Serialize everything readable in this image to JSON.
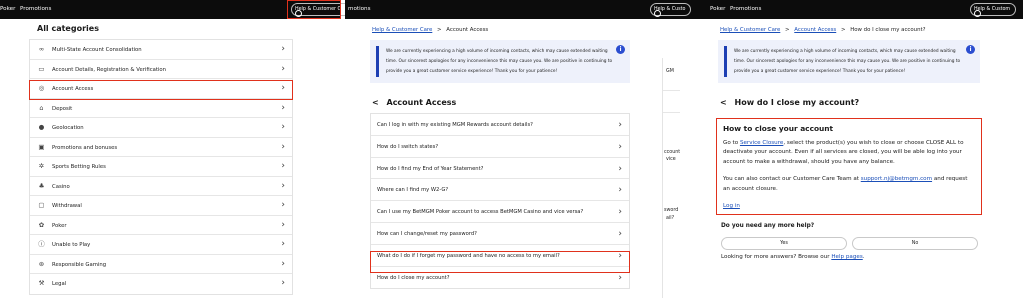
{
  "panel1": {
    "nav": [
      "Poker",
      "Promotions"
    ],
    "help_btn": "Help & Customer Care",
    "title": "All categories",
    "categories": [
      {
        "label": "Multi-State Account Consolidation",
        "icon": "link-icon"
      },
      {
        "label": "Account Details, Registration & Verification",
        "icon": "id-card-icon"
      },
      {
        "label": "Account Access",
        "icon": "access-icon"
      },
      {
        "label": "Deposit",
        "icon": "bank-icon"
      },
      {
        "label": "Geolocation",
        "icon": "location-pin-icon"
      },
      {
        "label": "Promotions and bonuses",
        "icon": "gift-icon"
      },
      {
        "label": "Sports Betting Rules",
        "icon": "rules-icon"
      },
      {
        "label": "Casino",
        "icon": "casino-icon"
      },
      {
        "label": "Withdrawal",
        "icon": "withdrawal-icon"
      },
      {
        "label": "Poker",
        "icon": "poker-chip-icon"
      },
      {
        "label": "Unable to Play",
        "icon": "info-icon"
      },
      {
        "label": "Responsible Gaming",
        "icon": "responsible-gaming-icon"
      },
      {
        "label": "Legal",
        "icon": "gavel-icon"
      }
    ]
  },
  "panel2": {
    "nav": [
      "motions"
    ],
    "sliver_text": [
      "GM",
      "ccount",
      "vice",
      "sword",
      "ail?"
    ],
    "breadcrumb": {
      "root": "Help & Customer Care",
      "sep": ">",
      "current": "Account Access"
    },
    "notice": "We are currently experiencing a high volume of incoming contacts, which may cause extended waiting time. Our sincerest apologies for any inconvenience this may cause you. We are positive in continuing to provide you a great customer service experience! Thank you for your patience!",
    "title": "Account Access",
    "back_glyph": "<",
    "questions": [
      "Can I log in with my existing MGM Rewards account details?",
      "How do I switch states?",
      "How do I find my End of Year Statement?",
      "Where can I find my W2-G?",
      "Can I use my BetMGM Poker account to access BetMGM Casino and vice versa?",
      "How can I change/reset my password?",
      "What do I do if I forget my password and have no access to my email?",
      "How do I close my account?"
    ]
  },
  "panel3": {
    "nav": [
      "Poker",
      "Promotions"
    ],
    "help_btn_clipped": "Help & Custo",
    "help_btn": "Help & Custom",
    "breadcrumb": {
      "root": "Help & Customer Care",
      "sep": ">",
      "mid": "Account Access",
      "current": "How do I close my account?"
    },
    "notice": "We are currently experiencing a high volume of incoming contacts, which may cause extended waiting time. Our sincerest apologies for any inconvenience this may cause you. We are positive in continuing to provide you a great customer service experience! Thank you for your patience!",
    "title": "How do I close my account?",
    "answer": {
      "heading": "How to close your account",
      "p1_pre": "Go to ",
      "p1_link": "Service Closure",
      "p1_post": ", select the product(s) you wish to close or choose CLOSE ALL to deactivate your account. Even if all services are closed, you will be able log into your account to make a withdrawal, should you have any balance.",
      "p2_pre": "You can also contact our Customer Care Team at ",
      "p2_link": "support.nj@betmgm.com",
      "p2_post": " and request an account closure.",
      "login_link": "Log in"
    },
    "help_question": "Do you need any more help?",
    "yes": "Yes",
    "no": "No",
    "more_pre": "Looking for more answers? Browse our ",
    "more_link": "Help pages",
    "more_post": "."
  },
  "colors": {
    "topbar": "#0c0c0c",
    "highlight": "#e0311c",
    "link": "#1b4fb8",
    "notice_bg": "#eef1fb",
    "notice_bar": "#1d3fb3"
  }
}
